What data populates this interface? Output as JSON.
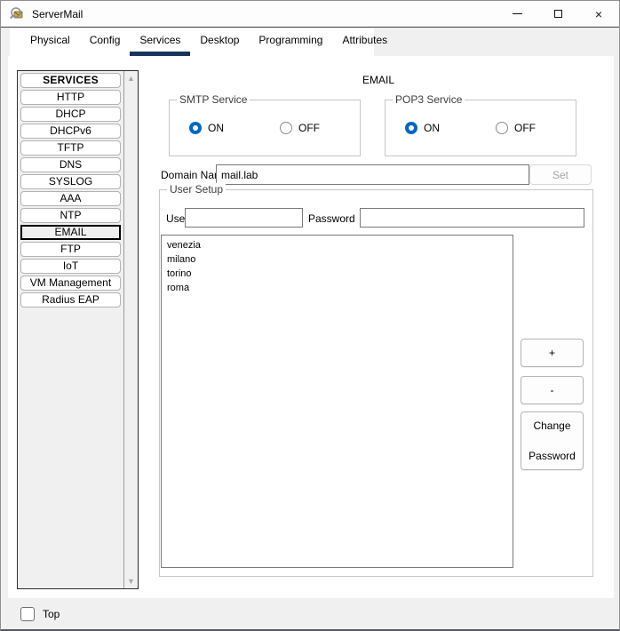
{
  "window": {
    "title": "ServerMail",
    "icons": {
      "minimize": "minus-line",
      "maximize": "square-outline",
      "close": "×",
      "scroll_up": "▲",
      "scroll_down": "▼"
    }
  },
  "tabs": {
    "items": [
      "Physical",
      "Config",
      "Services",
      "Desktop",
      "Programming",
      "Attributes"
    ],
    "active": "Services"
  },
  "sidebar": {
    "header": "SERVICES",
    "items": [
      "HTTP",
      "DHCP",
      "DHCPv6",
      "TFTP",
      "DNS",
      "SYSLOG",
      "AAA",
      "NTP",
      "EMAIL",
      "FTP",
      "IoT",
      "VM Management",
      "Radius EAP"
    ],
    "selected": "EMAIL"
  },
  "email": {
    "title": "EMAIL",
    "smtp": {
      "label": "SMTP Service",
      "on_label": "ON",
      "off_label": "OFF",
      "value": "ON"
    },
    "pop3": {
      "label": "POP3 Service",
      "on_label": "ON",
      "off_label": "OFF",
      "value": "ON"
    },
    "domain": {
      "label": "Domain Name:",
      "value": "mail.lab",
      "set_label": "Set"
    },
    "user_setup": {
      "label": "User Setup",
      "user_label": "User",
      "user_value": "",
      "password_label": "Password",
      "password_value": "",
      "users": [
        "venezia",
        "milano",
        "torino",
        "roma"
      ],
      "add_label": "+",
      "remove_label": "-",
      "change_password_line1": "Change",
      "change_password_line2": "Password"
    }
  },
  "footer": {
    "top_label": "Top",
    "top_checked": false
  },
  "colors": {
    "accent": "#0067c0",
    "tab_underline": "#16365c"
  }
}
